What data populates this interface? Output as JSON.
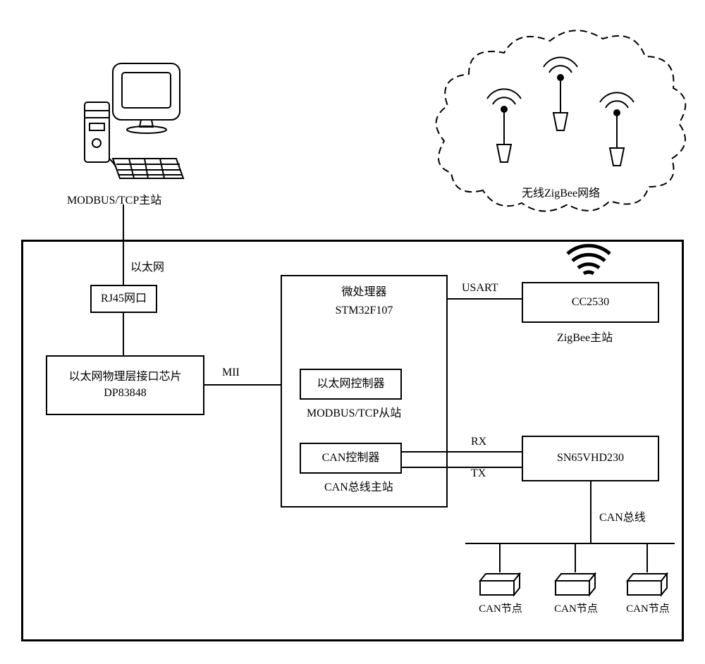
{
  "computer_label": "MODBUS/TCP主站",
  "ethernet_label": "以太网",
  "rj45_box": "RJ45网口",
  "phy_chip_line1": "以太网物理层接口芯片",
  "phy_chip_line2": "DP83848",
  "mii_label": "MII",
  "mcu_line1": "微处理器",
  "mcu_line2": "STM32F107",
  "eth_ctrl": "以太网控制器",
  "eth_ctrl_sub": "MODBUS/TCP从站",
  "can_ctrl": "CAN控制器",
  "can_ctrl_sub": "CAN总线主站",
  "usart_label": "USART",
  "cc2530": "CC2530",
  "zigbee_master": "ZigBee主站",
  "rx_label": "RX",
  "tx_label": "TX",
  "can_transceiver": "SN65VHD230",
  "can_bus_label": "CAN总线",
  "can_node_label": "CAN节点",
  "zigbee_cloud": "无线ZigBee网络"
}
